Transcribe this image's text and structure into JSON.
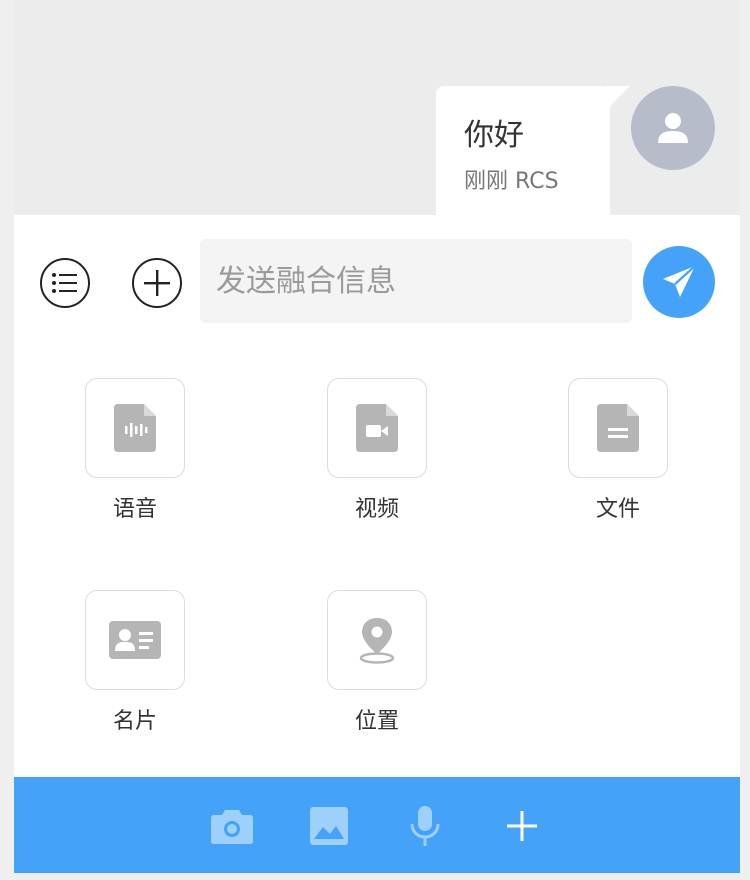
{
  "message": {
    "text": "你好",
    "time": "刚刚",
    "type": "RCS"
  },
  "input": {
    "placeholder": "发送融合信息",
    "value": ""
  },
  "icons": {
    "menu": "list-icon",
    "add": "plus-circle-icon",
    "send": "paper-plane-icon",
    "avatar": "user-icon"
  },
  "attachments": [
    {
      "label": "语音",
      "icon": "audio-file-icon"
    },
    {
      "label": "视频",
      "icon": "video-file-icon"
    },
    {
      "label": "文件",
      "icon": "document-file-icon"
    },
    {
      "label": "名片",
      "icon": "contact-card-icon"
    },
    {
      "label": "位置",
      "icon": "location-pin-icon"
    }
  ],
  "bottom_bar": {
    "items": [
      "camera-icon",
      "image-icon",
      "microphone-icon",
      "plus-icon"
    ]
  },
  "colors": {
    "accent": "#44a2f8",
    "avatar_bg": "#b7bccb",
    "icon_gray": "#b5b5b5",
    "chat_bg": "#ececec"
  }
}
